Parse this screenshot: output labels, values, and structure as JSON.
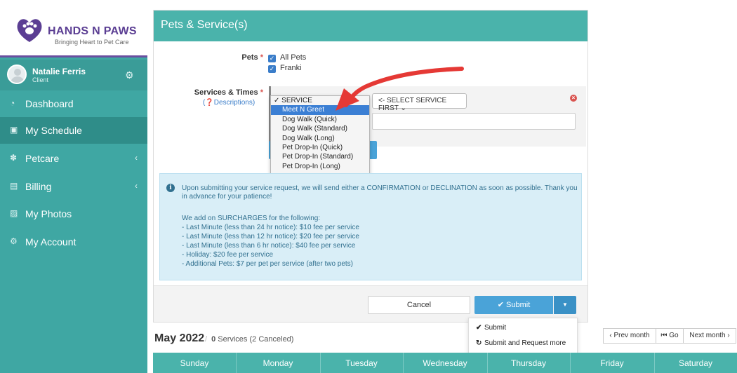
{
  "brand": {
    "name": "HANDS N PAWS",
    "tagline": "Bringing Heart to Pet Care",
    "primary_color": "#3fa7a3",
    "logo_color": "#5b3e93"
  },
  "user": {
    "name": "Natalie Ferris",
    "role": "Client"
  },
  "sidebar": {
    "items": [
      {
        "label": "Dashboard",
        "icon": "dashboard-icon"
      },
      {
        "label": "My Schedule",
        "icon": "calendar-icon",
        "active": true
      },
      {
        "label": "Petcare",
        "icon": "paw-icon",
        "has_submenu": true
      },
      {
        "label": "Billing",
        "icon": "file-icon",
        "has_submenu": true
      },
      {
        "label": "My Photos",
        "icon": "photo-icon"
      },
      {
        "label": "My Account",
        "icon": "gears-icon"
      }
    ]
  },
  "panel": {
    "title": "Pets & Service(s)",
    "pets_label": "Pets",
    "pets": [
      "All Pets",
      "Franki"
    ],
    "services_label": "Services & Times",
    "descriptions_link": "Descriptions",
    "select_first": "<- SELECT SERVICE FIRST",
    "service_options": [
      "SERVICE",
      "Meet N Greet",
      "Dog Walk (Quick)",
      "Dog Walk (Standard)",
      "Dog Walk (Long)",
      "Pet Drop-In (Quick)",
      "Pet Drop-In (Standard)",
      "Pet Drop-In (Long)"
    ],
    "checked_option": "SERVICE",
    "highlighted_option": "Meet N Greet",
    "info_intro": "Upon submitting your service request, we will send either a CONFIRMATION or DECLINATION as soon as possible. Thank you in advance for your patience!",
    "surcharge_heading": "We add on SURCHARGES for the following:",
    "surcharges": [
      "- Last Minute (less than 24 hr notice): $10 fee per service",
      "- Last Minute (less than 12 hr notice): $20 fee per service",
      "- Last Minute (less than 6 hr notice): $40 fee per service",
      "- Holiday: $20 fee per service",
      "- Additional Pets: $7 per pet per service (after two pets)"
    ],
    "cancel_label": "Cancel",
    "submit_label": "Submit"
  },
  "submit_menu": {
    "items": [
      "Submit",
      "Submit and Request more"
    ]
  },
  "calendar": {
    "month": "May 2022",
    "service_count": "0",
    "services_suffix": "Services (2 Canceled)",
    "prev_label": "‹ Prev month",
    "go_label": "Go",
    "next_label": "Next month ›",
    "days": [
      "Sunday",
      "Monday",
      "Tuesday",
      "Wednesday",
      "Thursday",
      "Friday",
      "Saturday"
    ]
  }
}
